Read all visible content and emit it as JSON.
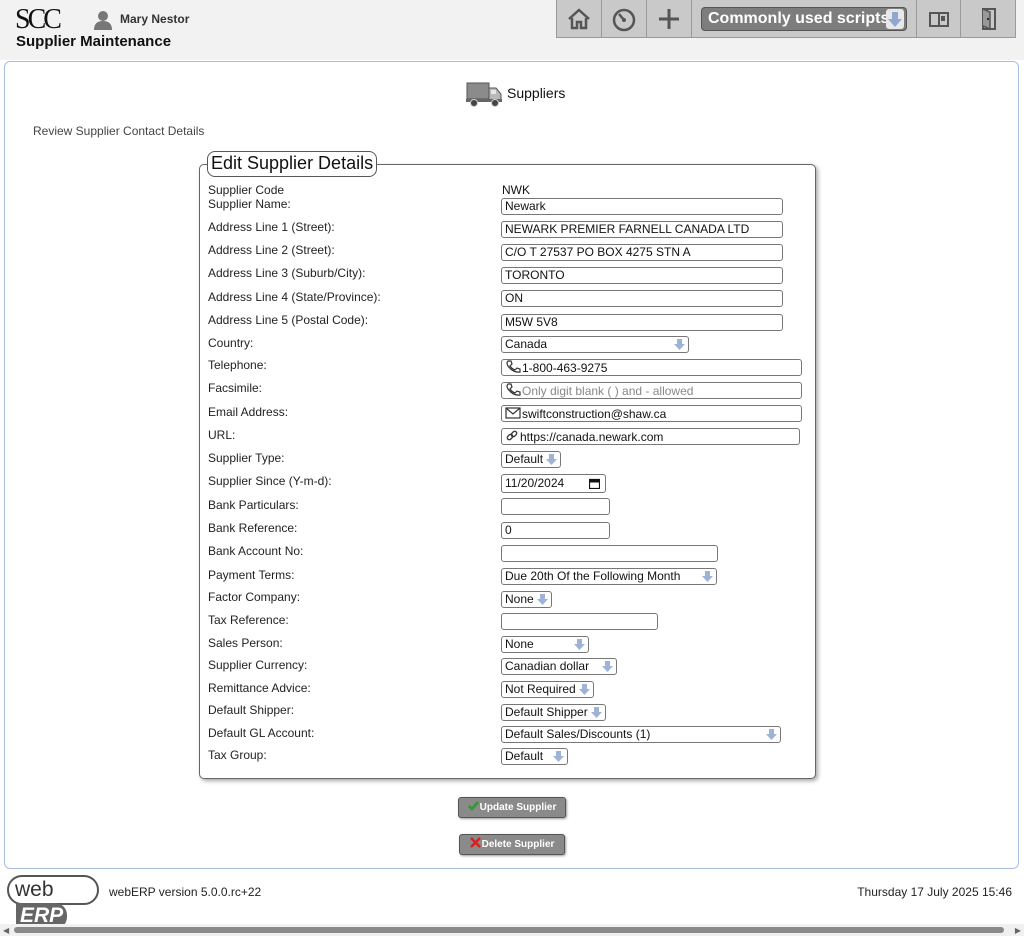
{
  "header": {
    "logo_text": "SCC",
    "user_name": "Mary Nestor",
    "page_title": "Supplier Maintenance",
    "scripts_select": "Commonly used scripts",
    "icons": [
      "home-icon",
      "dashboard-icon",
      "plus-icon",
      "manual-icon",
      "logout-icon"
    ]
  },
  "main": {
    "section_title": "Suppliers",
    "subtitle": "Review Supplier Contact Details",
    "form_legend": "Edit Supplier Details"
  },
  "form": {
    "labels": {
      "code": "Supplier Code",
      "name": "Supplier Name:",
      "addr1": "Address Line 1 (Street):",
      "addr2": "Address Line 2 (Street):",
      "addr3": "Address Line 3 (Suburb/City):",
      "addr4": "Address Line 4 (State/Province):",
      "addr5": "Address Line 5 (Postal Code):",
      "country": "Country:",
      "telephone": "Telephone:",
      "fax": "Facsimile:",
      "email": "Email Address:",
      "url": "URL:",
      "type": "Supplier Type:",
      "since": "Supplier Since (Y-m-d):",
      "bank_particulars": "Bank Particulars:",
      "bank_reference": "Bank Reference:",
      "bank_account": "Bank Account No:",
      "payment_terms": "Payment Terms:",
      "factor": "Factor Company:",
      "tax_reference": "Tax Reference:",
      "sales_person": "Sales Person:",
      "currency": "Supplier Currency:",
      "remittance": "Remittance Advice:",
      "shipper": "Default Shipper:",
      "gl_account": "Default GL Account:",
      "tax_group": "Tax Group:"
    },
    "values": {
      "code": "NWK",
      "name": "Newark",
      "addr1": "NEWARK PREMIER FARNELL CANADA LTD",
      "addr2": "C/O T 27537 PO BOX 4275 STN A",
      "addr3": "TORONTO",
      "addr4": "ON",
      "addr5": "M5W 5V8",
      "country": "Canada",
      "telephone": "1-800-463-9275",
      "fax_placeholder": "Only digit blank ( ) and - allowed",
      "email": "swiftconstruction@shaw.ca",
      "url": "https://canada.newark.com",
      "type": "Default",
      "since": "11/20/2024",
      "bank_particulars": "",
      "bank_reference": "0",
      "bank_account": "",
      "payment_terms": "Due 20th Of the Following Month",
      "factor": "None",
      "tax_reference": "",
      "sales_person": "None",
      "currency": "Canadian dollar",
      "remittance": "Not Required",
      "shipper": "Default Shipper",
      "gl_account": "Default Sales/Discounts (1)",
      "tax_group": "Default"
    }
  },
  "buttons": {
    "update": "Update Supplier",
    "delete": "Delete Supplier"
  },
  "footer": {
    "logo_web": "web",
    "logo_erp": "ERP",
    "version": "webERP version 5.0.0.rc+22",
    "datetime": "Thursday 17 July 2025 15:46"
  }
}
